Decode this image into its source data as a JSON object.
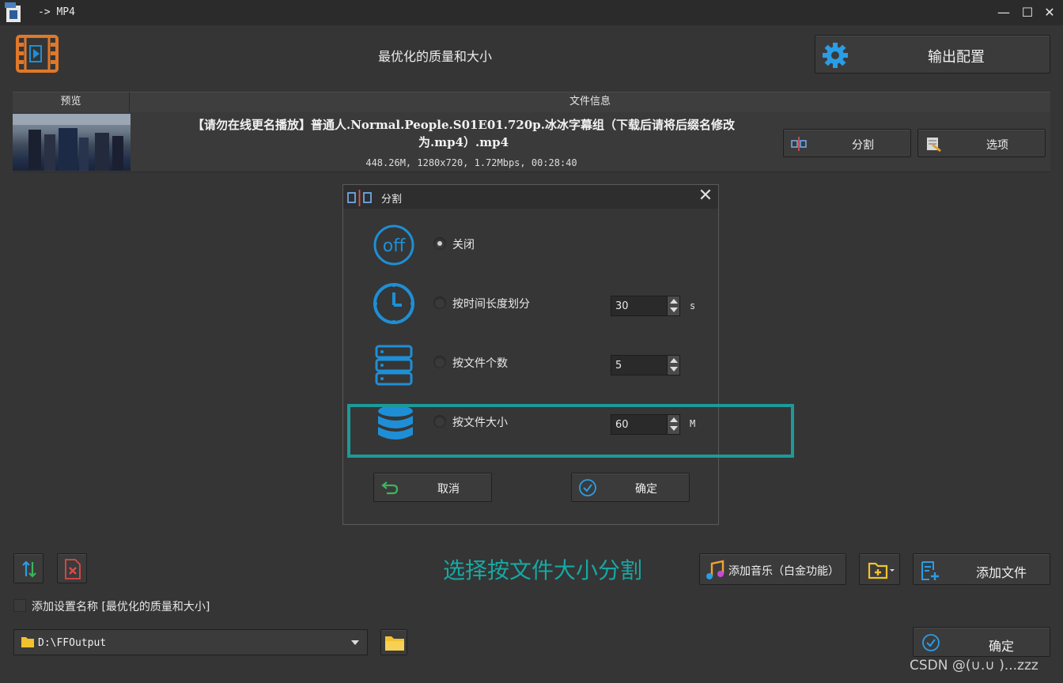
{
  "window": {
    "title": "-> MP4",
    "controls": [
      "minimize-icon",
      "maximize-icon",
      "close-icon"
    ]
  },
  "header": {
    "profile_title": "最优化的质量和大小",
    "output_config_label": "输出配置"
  },
  "table": {
    "columns": [
      "预览",
      "文件信息"
    ],
    "rows": [
      {
        "file_name": "【请勿在线更名播放】普通人.Normal.People.S01E01.720p.冰冰字幕组（下载后请将后缀名修改为.mp4）.mp4",
        "meta": "448.26M, 1280x720, 1.72Mbps, 00:28:40",
        "split_label": "分割",
        "options_label": "选项"
      }
    ]
  },
  "split_dialog": {
    "title": "分割",
    "options": [
      {
        "label": "关闭",
        "icon": "off-icon",
        "checked": true
      },
      {
        "label": "按时间长度划分",
        "icon": "clock-icon",
        "checked": false,
        "value": "30",
        "unit": "s"
      },
      {
        "label": "按文件个数",
        "icon": "server-stack-icon",
        "checked": false,
        "value": "5"
      },
      {
        "label": "按文件大小",
        "icon": "database-icon",
        "checked": false,
        "value": "60",
        "unit": "M"
      }
    ],
    "cancel_label": "取消",
    "confirm_label": "确定"
  },
  "annotation": {
    "caption": "选择按文件大小分割",
    "highlight_color": "#1d9a98"
  },
  "bottom": {
    "add_music_label": "添加音乐（白金功能）",
    "add_file_label": "添加文件",
    "add_name_checkbox_label": "添加设置名称 [最优化的质量和大小]",
    "output_path": "D:\\FFOutput",
    "ok_label": "确定"
  },
  "watermark": "CSDN @(∪.∪ )...zzz",
  "colors": {
    "background": "#353535",
    "accent_blue": "#1e8fd6",
    "accent_orange": "#e0782a",
    "teal": "#17a8a3"
  }
}
